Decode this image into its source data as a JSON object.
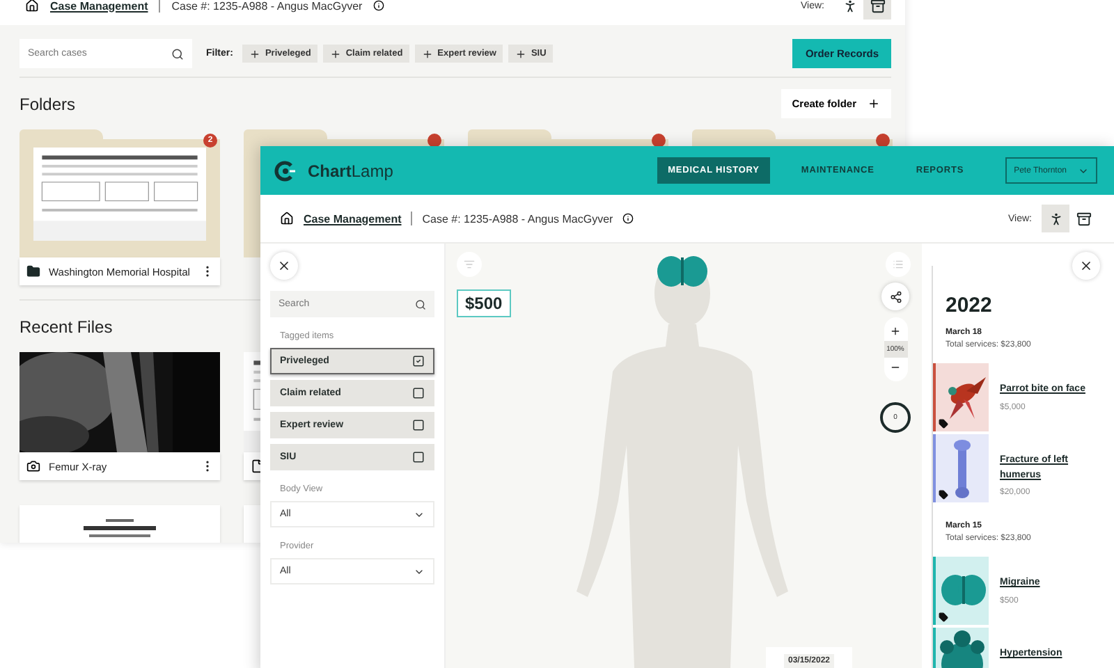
{
  "back_window": {
    "breadcrumb": {
      "link": "Case Management",
      "case": "Case #: 1235-A988 - Angus MacGyver"
    },
    "view": {
      "label": "View:",
      "options": [
        {
          "kind": "body",
          "selected": false
        },
        {
          "kind": "archive",
          "selected": true
        }
      ]
    },
    "search": {
      "placeholder": "Search cases"
    },
    "filter": {
      "label": "Filter:",
      "chips": [
        "Priveleged",
        "Claim related",
        "Expert review",
        "SIU"
      ]
    },
    "order_button": "Order Records",
    "folders": {
      "title": "Folders",
      "create_button": "Create folder",
      "items": [
        {
          "name": "Washington Memorial Hospital",
          "badge": "2",
          "flagged": true
        },
        {
          "flagged": true
        },
        {
          "flagged": true
        },
        {
          "flagged": true
        }
      ]
    },
    "recent": {
      "title": "Recent Files",
      "items": [
        {
          "name": "Femur X-ray"
        },
        {
          "kind": "document"
        },
        {
          "kind": "form"
        },
        {
          "kind": "form"
        }
      ]
    }
  },
  "app": {
    "logo": "**Chart**Lamp",
    "nav": [
      {
        "label": "MEDICAL HISTORY",
        "selected": true
      },
      {
        "label": "MAINTENANCE",
        "selected": false
      },
      {
        "label": "REPORTS",
        "selected": false
      }
    ],
    "user": "Pete Thornton",
    "breadcrumb": {
      "link": "Case Management",
      "case": "Case #: 1235-A988 - Angus MacGyver"
    },
    "view": {
      "label": "View:",
      "options": [
        {
          "kind": "body",
          "selected": true
        },
        {
          "kind": "archive",
          "selected": false
        }
      ]
    },
    "filters": {
      "search": {
        "placeholder": "Search"
      },
      "tagged_label": "Tagged items",
      "tags": [
        {
          "label": "Priveleged",
          "checked": true
        },
        {
          "label": "Claim related",
          "checked": false
        },
        {
          "label": "Expert review",
          "checked": false
        },
        {
          "label": "SIU",
          "checked": false
        }
      ],
      "body_view": {
        "label": "Body View",
        "value": "All"
      },
      "provider": {
        "label": "Provider",
        "value": "All"
      }
    },
    "canvas": {
      "amount": "$500",
      "zoom": "100%",
      "dial": "0",
      "date": "03/15/2022"
    },
    "history": {
      "year": "2022",
      "groups": [
        {
          "date": "March 18",
          "total": "Total services: $23,800",
          "items": [
            {
              "title": "Parrot bite on face",
              "amount": "$5,000",
              "color": "#c9503f",
              "kind": "bird",
              "tagged": true
            },
            {
              "title": "Fracture of left humerus",
              "amount": "$20,000",
              "color": "#8090e0",
              "kind": "bone",
              "tagged": true
            }
          ]
        },
        {
          "date": "March 15",
          "total": "Total services: $23,800",
          "items": [
            {
              "title": "Migraine",
              "amount": "$500",
              "color": "#1fb5ad",
              "kind": "brain",
              "tagged": true
            },
            {
              "title": "Hypertension",
              "color": "#1fb5ad",
              "kind": "heart"
            }
          ]
        }
      ]
    }
  }
}
